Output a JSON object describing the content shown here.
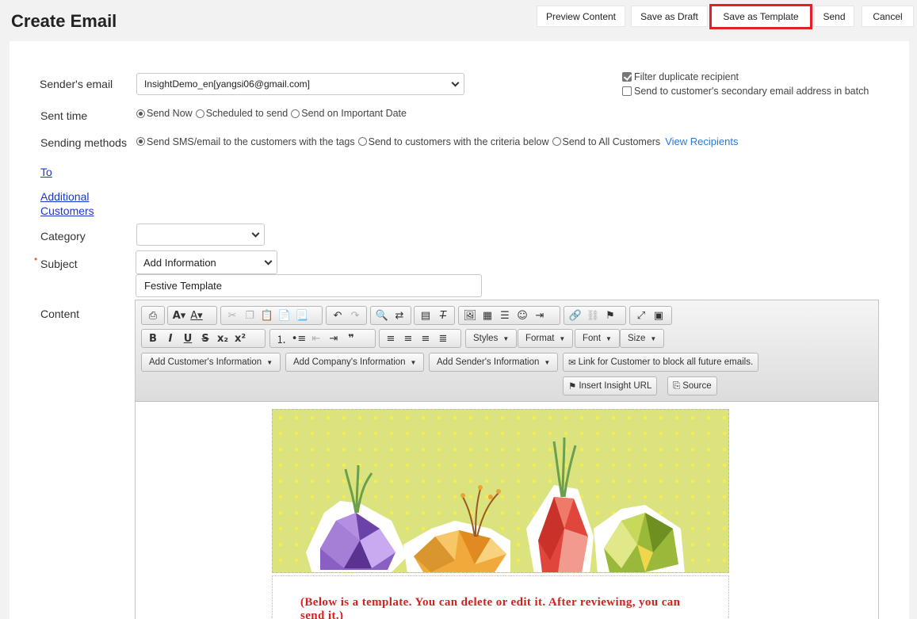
{
  "header": {
    "title": "Create Email",
    "buttons": {
      "preview": "Preview Content",
      "draft": "Save as Draft",
      "template": "Save as Template",
      "send": "Send",
      "cancel": "Cancel"
    }
  },
  "form": {
    "sender_label": "Sender's email",
    "sender_value": "InsightDemo_en[yangsi06@gmail.com]",
    "filter_duplicate": "Filter duplicate recipient",
    "secondary_email": "Send to customer's secondary email address in batch",
    "sent_time_label": "Sent time",
    "sent_time_options": [
      "Send Now",
      "Scheduled to send",
      "Send on Important Date"
    ],
    "sending_methods_label": "Sending methods",
    "sending_methods_options": [
      "Send SMS/email to the customers with the tags",
      "Send to customers with the criteria below",
      "Send to All Customers"
    ],
    "view_recipients": "View Recipients",
    "to_link": "To",
    "additional_line1": "Additional",
    "additional_line2": "Customers",
    "category_label": "Category",
    "category_value": "",
    "subject_label": "Subject",
    "subject_select": "Add Information",
    "subject_value": "Festive Template",
    "content_label": "Content"
  },
  "toolbar": {
    "styles": "Styles",
    "format": "Format",
    "font": "Font",
    "size": "Size",
    "add_customer_info": "Add Customer's Information",
    "add_company_info": "Add Company's Information",
    "add_sender_info": "Add Sender's Information",
    "block_link": "Link for Customer to block all future emails.",
    "insight_url": "Insert Insight URL",
    "source": "Source"
  },
  "content": {
    "note_line1": "(Below is a template. You can delete or edit it. After reviewing, you can",
    "note_line2": "send it.)"
  }
}
